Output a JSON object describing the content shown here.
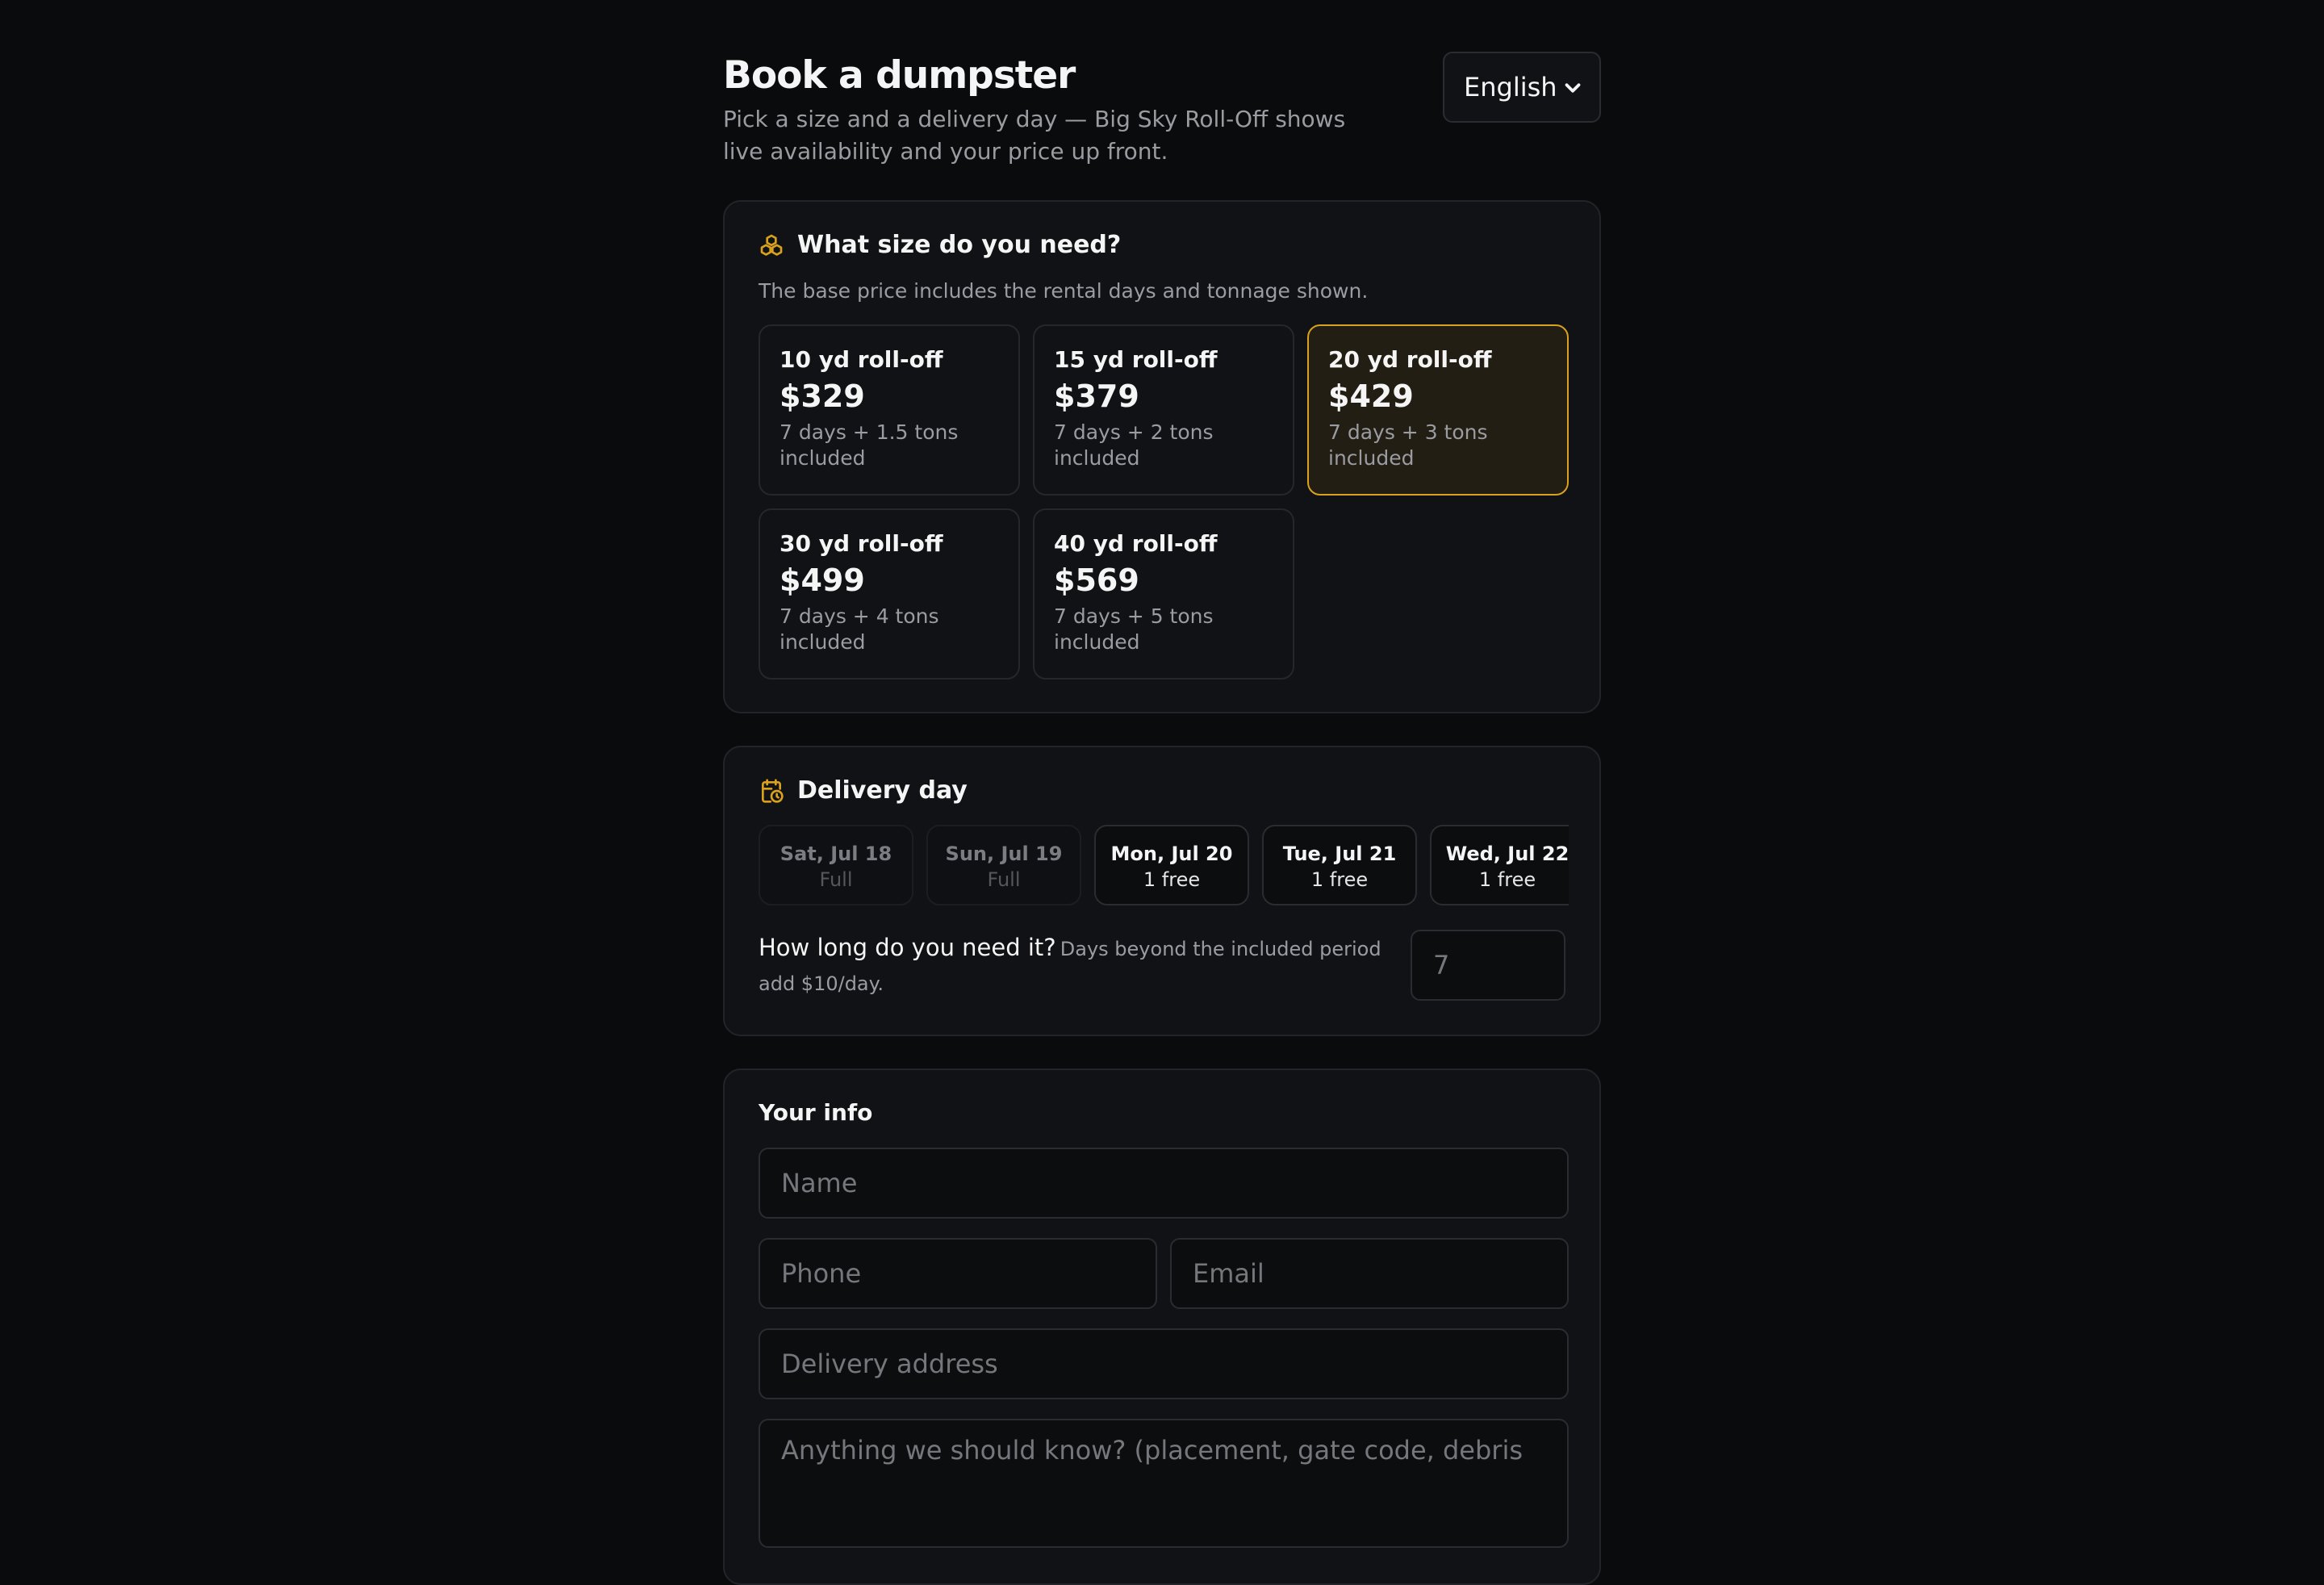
{
  "header": {
    "title": "Book a dumpster",
    "subtitle": "Pick a size and a delivery day — Big Sky Roll-Off shows live availability and your price up front.",
    "language_selected": "English"
  },
  "size_section": {
    "icon": "boxes-icon",
    "title": "What size do you need?",
    "note": "The base price includes the rental days and tonnage shown.",
    "selected_index": 2,
    "options": [
      {
        "name": "10 yd roll-off",
        "price": "$329",
        "desc": "7 days + 1.5 tons included"
      },
      {
        "name": "15 yd roll-off",
        "price": "$379",
        "desc": "7 days + 2 tons included"
      },
      {
        "name": "20 yd roll-off",
        "price": "$429",
        "desc": "7 days + 3 tons included"
      },
      {
        "name": "30 yd roll-off",
        "price": "$499",
        "desc": "7 days + 4 tons included"
      },
      {
        "name": "40 yd roll-off",
        "price": "$569",
        "desc": "7 days + 5 tons included"
      }
    ]
  },
  "delivery_section": {
    "icon": "calendar-clock-icon",
    "title": "Delivery day",
    "days": [
      {
        "date": "Sat, Jul 18",
        "availability": "Full",
        "full": true
      },
      {
        "date": "Sun, Jul 19",
        "availability": "Full",
        "full": true
      },
      {
        "date": "Mon, Jul 20",
        "availability": "1 free",
        "full": false
      },
      {
        "date": "Tue, Jul 21",
        "availability": "1 free",
        "full": false
      },
      {
        "date": "Wed, Jul 22",
        "availability": "1 free",
        "full": false
      }
    ],
    "duration_question": "How long do you need it?",
    "duration_hint": "Days beyond the included period add $10/day.",
    "duration_placeholder": "7"
  },
  "info_section": {
    "title": "Your info",
    "name_placeholder": "Name",
    "phone_placeholder": "Phone",
    "email_placeholder": "Email",
    "address_placeholder": "Delivery address",
    "notes_placeholder": "Anything we should know? (placement, gate code, debris"
  },
  "colors": {
    "accent": "#d9a11c",
    "background": "#0a0b0d",
    "card": "#111215"
  }
}
